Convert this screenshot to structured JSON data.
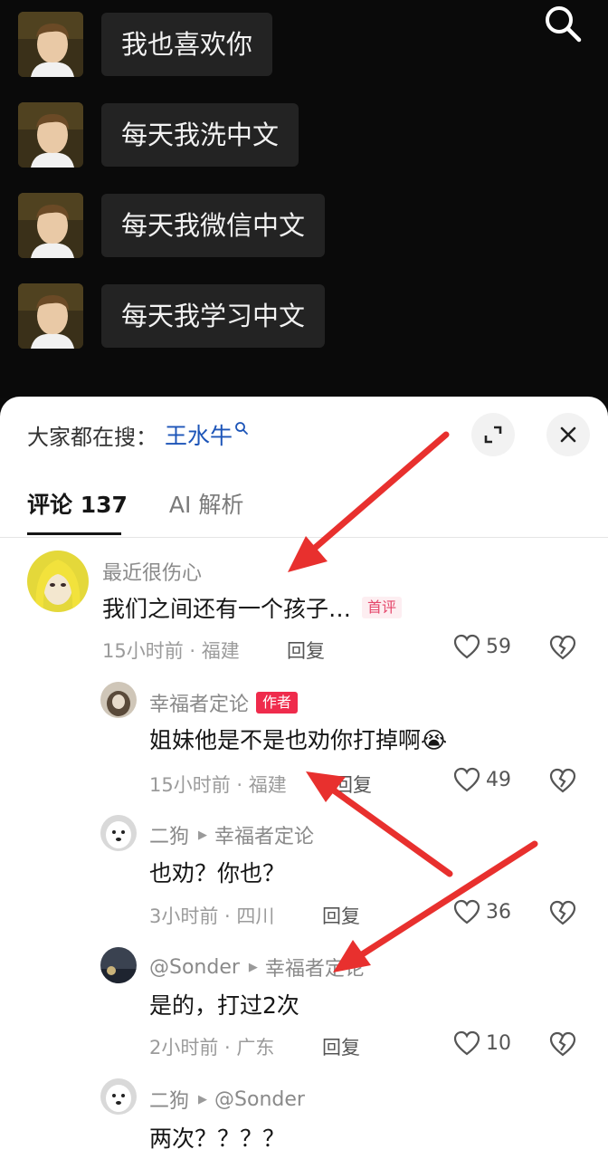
{
  "chat": {
    "messages": [
      {
        "text": "我也喜欢你"
      },
      {
        "text": "每天我洗中文"
      },
      {
        "text": "每天我微信中文"
      },
      {
        "text": "每天我学习中文"
      }
    ]
  },
  "sheet": {
    "hot_search_prefix": "大家都在搜：",
    "hot_search_term": "王水牛",
    "tabs": [
      {
        "label": "评论 137"
      },
      {
        "label": "AI 解析"
      }
    ]
  },
  "comments": [
    {
      "name": "最近很伤心",
      "text": "我们之间还有一个孩子…",
      "badge": "首评",
      "meta": "15小时前 · 福建",
      "reply": "回复",
      "likes": "59"
    },
    {
      "name": "幸福者定论",
      "badge": "作者",
      "text": "姐妹他是不是也劝你打掉啊😭",
      "meta": "15小时前 · 福建",
      "reply": "回复",
      "likes": "49"
    },
    {
      "name": "二狗",
      "reply_to": "幸福者定论",
      "text": "也劝？你也？",
      "meta": "3小时前 · 四川",
      "reply": "回复",
      "likes": "36"
    },
    {
      "name": "@Sonder",
      "reply_to": "幸福者定论",
      "text": "是的，打过2次",
      "meta": "2小时前 · 广东",
      "reply": "回复",
      "likes": "10"
    },
    {
      "name": "二狗",
      "reply_to": "@Sonder",
      "text": "两次？？？？"
    }
  ],
  "colors": {
    "accent_link": "#1d55b8",
    "author_badge": "#ef2b4c",
    "annotation_arrow": "#e8302e"
  },
  "icons": [
    "search-icon",
    "expand-icon",
    "close-icon",
    "heart-icon",
    "broken-heart-icon",
    "triangle-arrow-icon"
  ]
}
